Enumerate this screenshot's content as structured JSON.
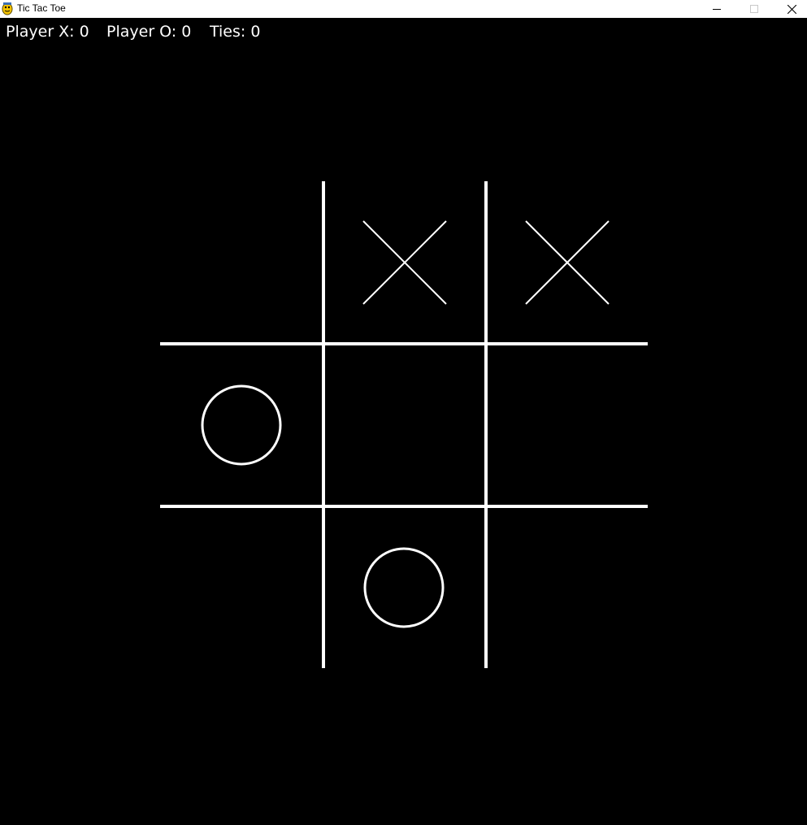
{
  "window": {
    "title": "Tic Tac Toe",
    "icon": "pygame-snake-icon",
    "controls": [
      "minimize-icon",
      "maximize-icon",
      "close-icon"
    ]
  },
  "scoreboard": {
    "player_x": "Player X: 0",
    "player_o": "Player O: 0",
    "ties": "Ties: 0"
  },
  "colors": {
    "background": "#000000",
    "foreground": "#ffffff"
  },
  "board": {
    "cells": [
      [
        "",
        "X",
        "X"
      ],
      [
        "O",
        "",
        ""
      ],
      [
        "",
        "O",
        ""
      ]
    ]
  }
}
